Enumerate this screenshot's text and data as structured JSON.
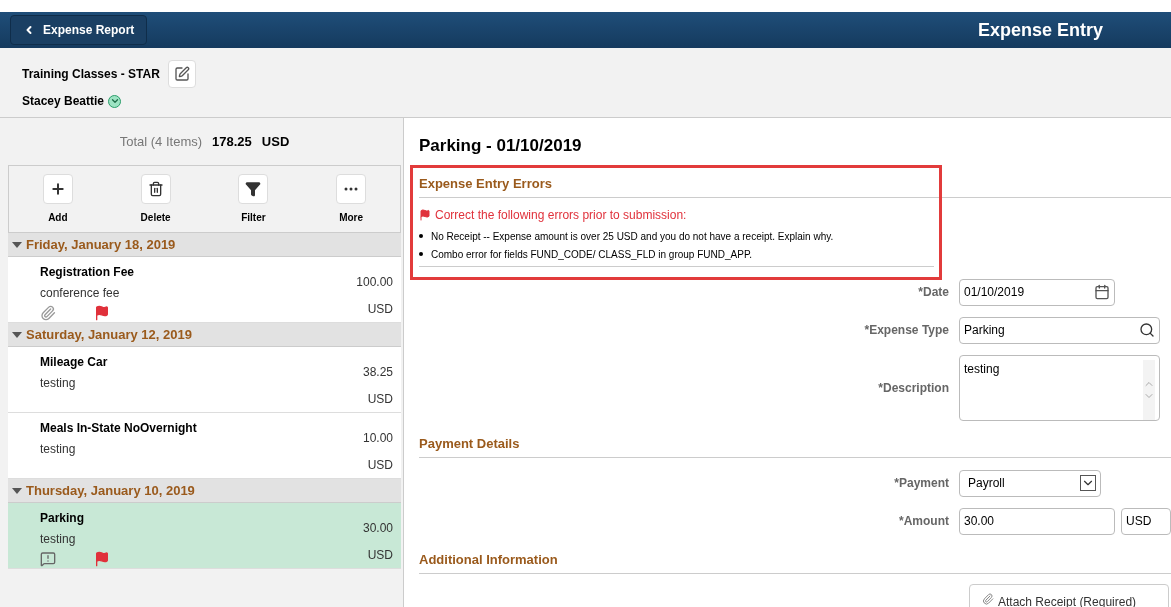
{
  "top_bar": {
    "back_button": "Expense Report",
    "title": "Expense Entry"
  },
  "header": {
    "report_name": "Training Classes - STAR",
    "employee": "Stacey Beattie"
  },
  "summary": {
    "label": "Total (4 Items)",
    "amount": "178.25",
    "currency": "USD"
  },
  "toolbar": [
    {
      "kind": "add",
      "label": "Add"
    },
    {
      "kind": "delete",
      "label": "Delete"
    },
    {
      "kind": "filter",
      "label": "Filter"
    },
    {
      "kind": "more",
      "label": "More"
    }
  ],
  "groups": [
    {
      "date": "Friday, January 18, 2019",
      "expanded": true,
      "items": [
        {
          "name": "Registration Fee",
          "description": "conference fee",
          "amount": "100.00",
          "currency": "USD",
          "selected": false,
          "attachment": true,
          "flagged": true,
          "receipt_warning": false
        }
      ]
    },
    {
      "date": "Saturday, January 12, 2019",
      "expanded": true,
      "items": [
        {
          "name": "Mileage Car",
          "description": "testing",
          "amount": "38.25",
          "currency": "USD",
          "selected": false,
          "attachment": false,
          "flagged": false,
          "receipt_warning": false
        },
        {
          "name": "Meals In-State NoOvernight",
          "description": "testing",
          "amount": "10.00",
          "currency": "USD",
          "selected": false,
          "attachment": false,
          "flagged": false,
          "receipt_warning": false
        }
      ]
    },
    {
      "date": "Thursday, January 10, 2019",
      "expanded": true,
      "items": [
        {
          "name": "Parking",
          "description": "testing",
          "amount": "30.00",
          "currency": "USD",
          "selected": true,
          "attachment": false,
          "flagged": true,
          "receipt_warning": true
        }
      ]
    }
  ],
  "detail": {
    "title": "Parking - 01/10/2019",
    "errors": {
      "heading": "Expense Entry Errors",
      "message": "Correct the following errors prior to submission:",
      "items": [
        "No Receipt -- Expense amount is over 25 USD and you do not have a receipt.  Explain why.",
        "Combo error for fields FUND_CODE/ CLASS_FLD in group FUND_APP."
      ]
    },
    "fields": [
      {
        "kind": "date",
        "label": "*Date",
        "value": "01/10/2019"
      },
      {
        "kind": "lookup",
        "label": "*Expense Type",
        "value": "Parking"
      },
      {
        "kind": "textarea",
        "label": "*Description",
        "value": "testing"
      }
    ],
    "payment_heading": "Payment Details",
    "payment_fields": [
      {
        "kind": "select",
        "label": "*Payment",
        "value": "Payroll"
      },
      {
        "kind": "amount",
        "label": "*Amount",
        "value": "30.00",
        "currency": "USD"
      }
    ],
    "additional_heading": "Additional Information",
    "attach_button": "Attach Receipt (Required)"
  }
}
